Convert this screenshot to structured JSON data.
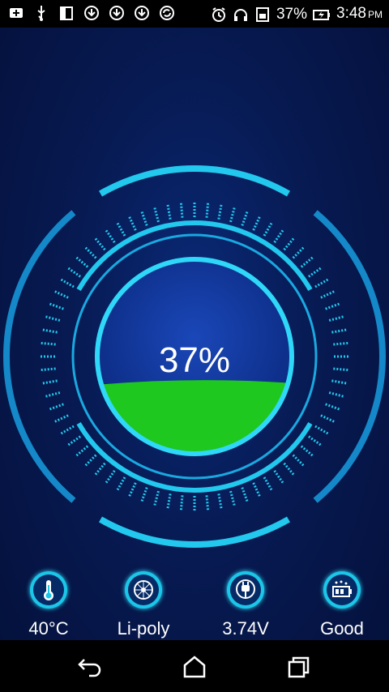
{
  "status_bar": {
    "left_icons": [
      "add-icon",
      "usb-icon",
      "sim-icon",
      "download-icon",
      "download-icon",
      "download-icon",
      "sync-icon"
    ],
    "right_icons": [
      "alarm-icon",
      "headset-icon",
      "memory-icon",
      "battery-charging-icon"
    ],
    "battery_percent": "37%",
    "time": "3:48",
    "ampm": "PM"
  },
  "gauge": {
    "percent_label": "37%",
    "level_fraction": 0.37,
    "colors": {
      "ring": "#22c8ee",
      "ring_dark": "#1488c8",
      "fill": "#1ec81e",
      "inner_bg": "#0c2e8a"
    }
  },
  "stats": [
    {
      "icon": "thermometer-icon",
      "label": "40°C"
    },
    {
      "icon": "battery-tech-icon",
      "label": "Li-poly"
    },
    {
      "icon": "plug-icon",
      "label": "3.74V"
    },
    {
      "icon": "battery-health-icon",
      "label": "Good"
    }
  ],
  "nav_bar": {
    "buttons": [
      "back-icon",
      "home-icon",
      "recents-icon"
    ]
  }
}
